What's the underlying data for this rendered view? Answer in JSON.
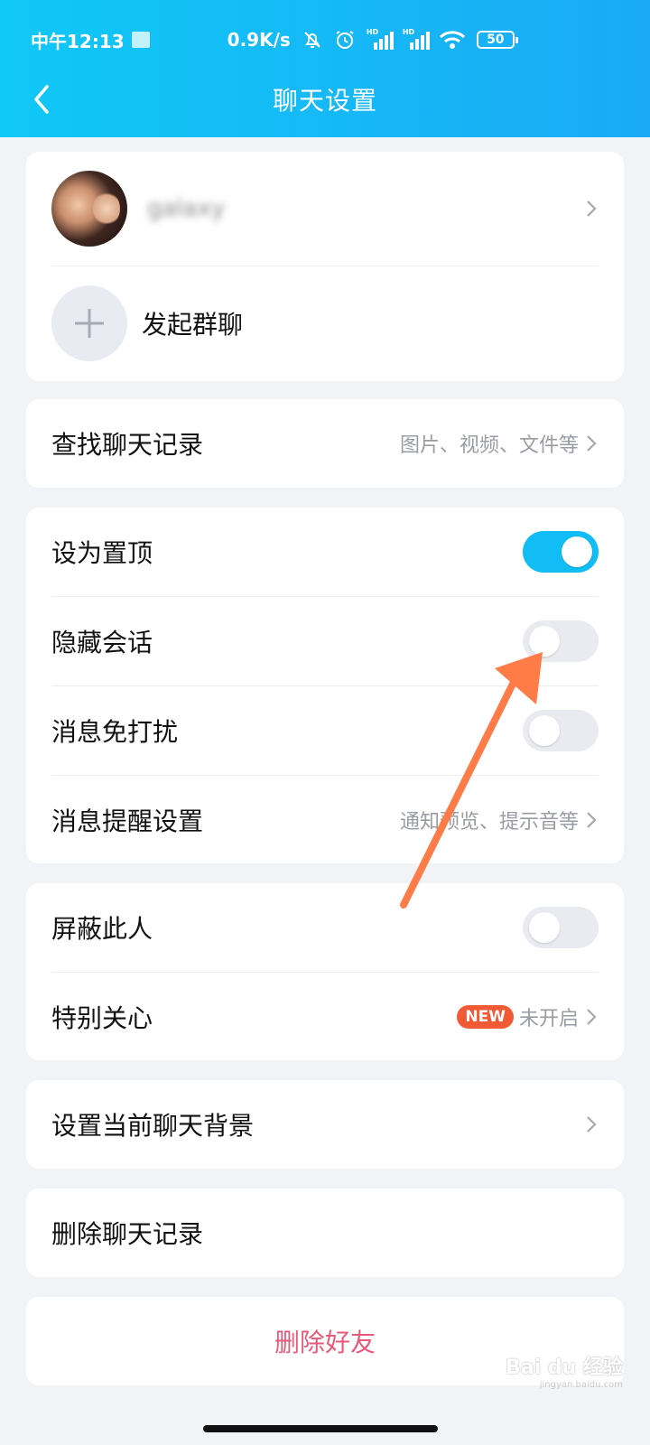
{
  "status_bar": {
    "time": "中午12:13",
    "network_speed": "0.9K/s",
    "battery": "50"
  },
  "nav": {
    "title": "聊天设置"
  },
  "profile": {
    "name": "galaxy",
    "create_group_label": "发起群聊"
  },
  "search_history": {
    "label": "查找聊天记录",
    "hint": "图片、视频、文件等"
  },
  "chat_options": {
    "pin_label": "设为置顶",
    "pin_on": true,
    "hide_label": "隐藏会话",
    "hide_on": false,
    "mute_label": "消息免打扰",
    "mute_on": false,
    "notify_label": "消息提醒设置",
    "notify_hint": "通知预览、提示音等"
  },
  "relationship": {
    "block_label": "屏蔽此人",
    "block_on": false,
    "special_care_label": "特别关心",
    "new_badge": "NEW",
    "special_care_status": "未开启"
  },
  "background": {
    "label": "设置当前聊天背景"
  },
  "delete_history": {
    "label": "删除聊天记录"
  },
  "delete_friend": {
    "label": "删除好友"
  },
  "watermark": {
    "text": "Bai du 经验",
    "url": "jingyan.baidu.com"
  },
  "colors": {
    "header_start": "#10c8f6",
    "header_end": "#1aaaf5",
    "toggle_on": "#12bdf5",
    "danger": "#e85a7a",
    "new_badge": "#f25a36",
    "arrow": "#ff7b47"
  }
}
